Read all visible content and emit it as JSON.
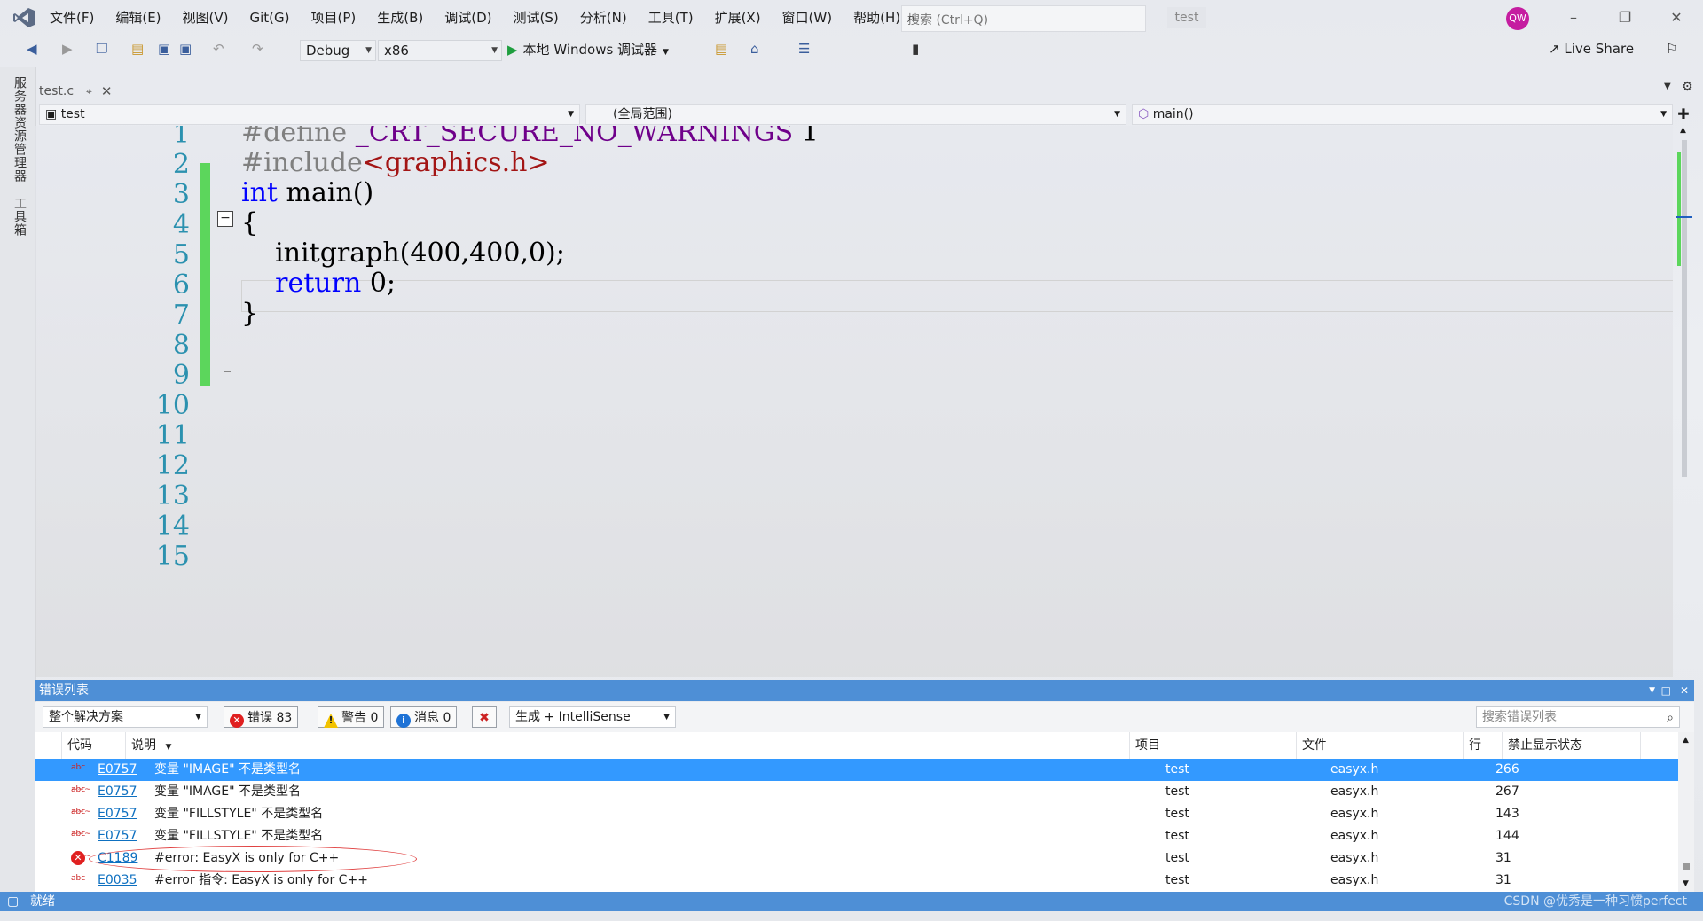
{
  "menu": [
    "文件(F)",
    "编辑(E)",
    "视图(V)",
    "Git(G)",
    "项目(P)",
    "生成(B)",
    "调试(D)",
    "测试(S)",
    "分析(N)",
    "工具(T)",
    "扩展(X)",
    "窗口(W)",
    "帮助(H)"
  ],
  "search": {
    "placeholder": "搜索 (Ctrl+Q)"
  },
  "solution_name": "test",
  "avatar_initials": "QW",
  "toolbar": {
    "config": "Debug",
    "platform": "x86",
    "run_label": "本地 Windows 调试器",
    "live_share": "Live Share"
  },
  "left_strip": {
    "server_explorer": "服务器资源管理器",
    "toolbox": "工具箱"
  },
  "doc_tab": {
    "filename": "test.c"
  },
  "navbar": {
    "project": "test",
    "scope": "(全局范围)",
    "member": "main()"
  },
  "editor": {
    "line_numbers": [
      "1",
      "2",
      "3",
      "4",
      "5",
      "6",
      "7",
      "8",
      "9",
      "10",
      "11",
      "12",
      "13",
      "14",
      "15"
    ],
    "line1": {
      "pp": "#define ",
      "macro": "_CRT_SECURE_NO_WARNINGS",
      "rest": " 1"
    },
    "line2": {
      "pp": "#include",
      "str": "<graphics.h>"
    },
    "line3": {
      "kw": "int",
      "rest": " main()"
    },
    "line4": "{",
    "line5": "    initgraph(400,400,0);",
    "line6": {
      "indent": "    ",
      "kw": "return",
      "rest": " 0;"
    },
    "line7": "}"
  },
  "error_list": {
    "title": "错误列表",
    "scope": "整个解决方案",
    "errors_label": "错误 83",
    "warnings_label": "警告 0",
    "messages_label": "消息 0",
    "build_filter": "生成 + IntelliSense",
    "search_placeholder": "搜索错误列表",
    "columns": {
      "code": "代码",
      "desc": "说明",
      "project": "项目",
      "file": "文件",
      "line": "行",
      "suppress": "禁止显示状态"
    },
    "rows": [
      {
        "code": "E0757",
        "desc": "变量 \"IMAGE\" 不是类型名",
        "project": "test",
        "file": "easyx.h",
        "line": "266"
      },
      {
        "code": "E0757",
        "desc": "变量 \"IMAGE\" 不是类型名",
        "project": "test",
        "file": "easyx.h",
        "line": "267"
      },
      {
        "code": "E0757",
        "desc": "变量 \"FILLSTYLE\" 不是类型名",
        "project": "test",
        "file": "easyx.h",
        "line": "143"
      },
      {
        "code": "E0757",
        "desc": "变量 \"FILLSTYLE\" 不是类型名",
        "project": "test",
        "file": "easyx.h",
        "line": "144"
      },
      {
        "code": "C1189",
        "desc": "#error:  EasyX is only for C++",
        "project": "test",
        "file": "easyx.h",
        "line": "31"
      },
      {
        "code": "E0035",
        "desc": "#error 指令: EasyX is only for C++",
        "project": "test",
        "file": "easyx.h",
        "line": "31"
      }
    ]
  },
  "status": {
    "text": "就绪",
    "watermark": "CSDN @优秀是一种习惯perfect"
  },
  "colors": {
    "accent": "#4e8fd6",
    "selection": "#3399ff",
    "change_bar": "#5cd65c",
    "keyword": "#0000ff",
    "macro": "#6f008a",
    "string": "#a31515",
    "line_number": "#2b91af"
  }
}
